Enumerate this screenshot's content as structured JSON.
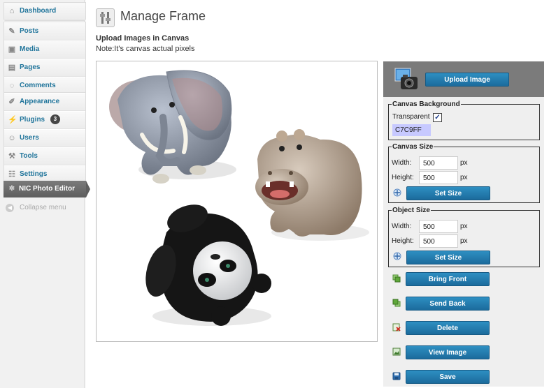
{
  "sidebar": {
    "items": [
      {
        "label": "Dashboard",
        "icon": "house-icon"
      },
      {
        "label": "Posts",
        "icon": "pin-icon"
      },
      {
        "label": "Media",
        "icon": "media-icon"
      },
      {
        "label": "Pages",
        "icon": "pages-icon"
      },
      {
        "label": "Comments",
        "icon": "comment-icon"
      },
      {
        "label": "Appearance",
        "icon": "brush-icon"
      },
      {
        "label": "Plugins",
        "icon": "plug-icon",
        "badge": "3"
      },
      {
        "label": "Users",
        "icon": "users-icon"
      },
      {
        "label": "Tools",
        "icon": "tools-icon"
      },
      {
        "label": "Settings",
        "icon": "settings-icon"
      }
    ],
    "active": {
      "label": "NIC Photo Editor",
      "icon": "gear-icon"
    },
    "collapse": "Collapse menu"
  },
  "header": {
    "title": "Manage Frame",
    "subtitle": "Upload Images in Canvas",
    "note": "Note:It's canvas actual pixels"
  },
  "panel": {
    "upload_label": "Upload Image",
    "canvas_background": {
      "legend": "Canvas Background",
      "transparent_label": "Transparent",
      "transparent_checked": "✓",
      "color_value": "C7C9FF",
      "color": "#C7C9FF"
    },
    "canvas_size": {
      "legend": "Canvas Size",
      "width_label": "Width:",
      "width_value": "500",
      "height_label": "Height:",
      "height_value": "500",
      "unit": "px",
      "set_label": "Set Size"
    },
    "object_size": {
      "legend": "Object Size",
      "width_label": "Width:",
      "width_value": "500",
      "height_label": "Height:",
      "height_value": "500",
      "unit": "px",
      "set_label": "Set Size"
    },
    "actions": [
      {
        "label": "Bring Front",
        "icon": "bring-front-icon"
      },
      {
        "label": "Send Back",
        "icon": "send-back-icon"
      },
      {
        "label": "Delete",
        "icon": "delete-icon"
      },
      {
        "label": "View Image",
        "icon": "view-image-icon"
      },
      {
        "label": "Save",
        "icon": "save-icon"
      }
    ]
  },
  "colors": {
    "accent": "#21759b",
    "button": "#1f78ab",
    "upload_bar": "#7b7b7b"
  }
}
